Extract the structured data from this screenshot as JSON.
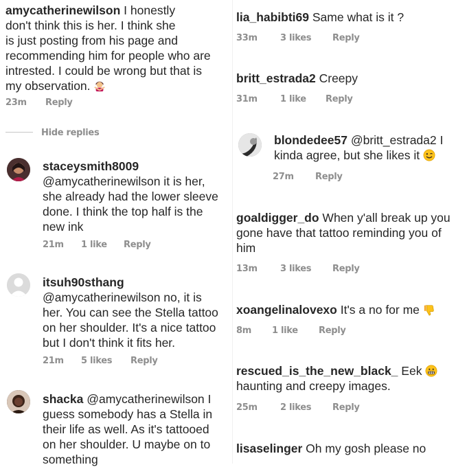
{
  "left": {
    "c1": {
      "user": "amycatherinewilson",
      "l1": " I honestly",
      "l2": "don't think this is her. I think she",
      "l3": "is just posting from his page and",
      "l4": "recommending him for people who are",
      "l5": "intrested. I could be wrong but that is",
      "l6": "my observation. ",
      "time": "23m",
      "reply": "Reply"
    },
    "hide": "Hide replies",
    "c2": {
      "user": "staceysmith8009",
      "l1": "@amycatherinewilson it is her,",
      "l2": "she already had the lower sleeve",
      "l3": "done. I think the top half is the",
      "l4": "new ink",
      "time": "21m",
      "likes": "1 like",
      "reply": "Reply"
    },
    "c3": {
      "user": "itsuh90sthang",
      "l1": "@amycatherinewilson no, it is",
      "l2": "her. You can see the Stella tattoo",
      "l3": "on her shoulder. It's a nice tattoo",
      "l4": "but I don't think it fits her.",
      "time": "21m",
      "likes": "5 likes",
      "reply": "Reply"
    },
    "c4": {
      "user": "shacka",
      "l1": " @amycatherinewilson I",
      "l2": "guess somebody has a Stella in",
      "l3": "their life as well. As it's tattooed",
      "l4": "on her shoulder. U maybe on to",
      "l5": "something"
    }
  },
  "right": {
    "c1": {
      "user": "lia_habibti69",
      "text": " Same what is it ?",
      "time": "33m",
      "likes": "3 likes",
      "reply": "Reply"
    },
    "c2": {
      "user": "britt_estrada2",
      "text": " Creepy",
      "time": "31m",
      "likes": "1 like",
      "reply": "Reply"
    },
    "c3": {
      "user": "blondedee57",
      "l1": " @britt_estrada2 I",
      "l2": "kinda agree, but she likes it ",
      "time": "27m",
      "reply": "Reply"
    },
    "c4": {
      "user": "goaldigger_do",
      "l1": " When y'all break up you",
      "l2": "gone have that tattoo reminding you of",
      "l3": "him",
      "time": "13m",
      "likes": "3 likes",
      "reply": "Reply"
    },
    "c5": {
      "user": "xoangelinalovexo",
      "text": " It's a no for me ",
      "time": "8m",
      "likes": "1 like",
      "reply": "Reply"
    },
    "c6": {
      "user": "rescued_is_the_new_black_",
      "l1": " Eek ",
      "l2": "haunting and creepy images.",
      "time": "25m",
      "likes": "2 likes",
      "reply": "Reply"
    },
    "c7": {
      "user": "lisaselinger",
      "text": " Oh my gosh please no"
    }
  },
  "icons": {
    "woman-gesturing-no": "woman-gesturing-no-icon",
    "wink": "winking-face-icon",
    "thumbs-down": "thumbs-down-icon",
    "grimace": "grimacing-face-icon"
  }
}
